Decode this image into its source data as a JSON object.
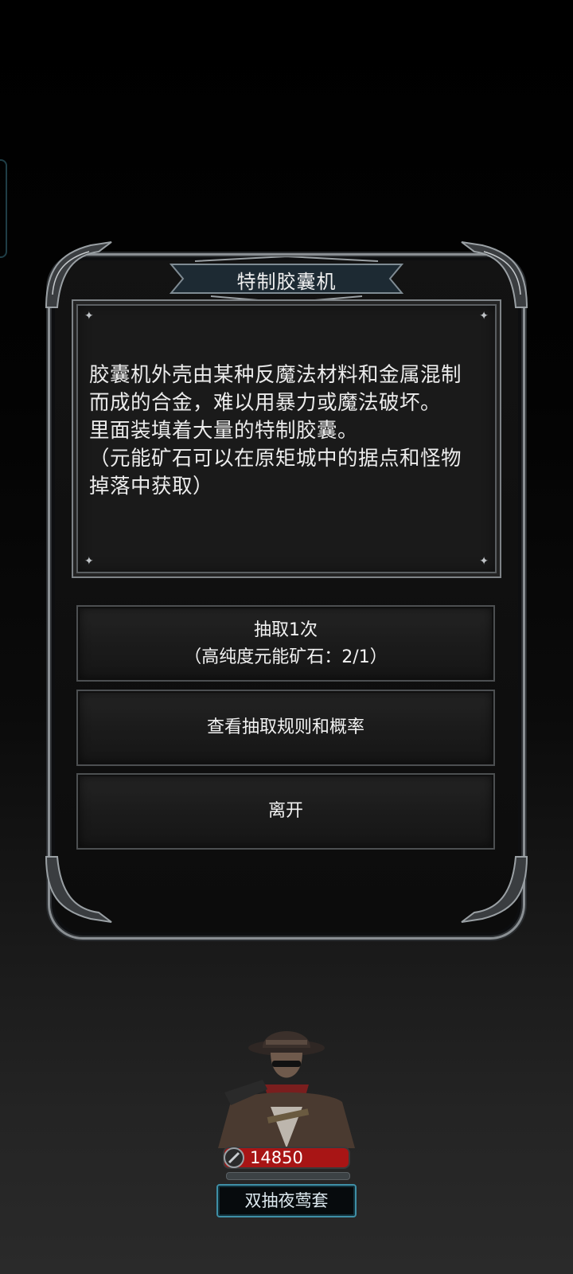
{
  "dialog": {
    "title": "特制胶囊机",
    "description": "胶囊机外壳由某种反魔法材料和金属混制\n而成的合金，难以用暴力或魔法破坏。\n里面装填着大量的特制胶囊。\n（元能矿石可以在原矩城中的据点和怪物\n掉落中获取）"
  },
  "buttons": {
    "draw": {
      "label": "抽取1次",
      "cost": "（高纯度元能矿石：2/1）"
    },
    "rules_label": "查看抽取规则和概率",
    "leave_label": "离开"
  },
  "character": {
    "hp": "14850",
    "name": "双抽夜莺套"
  },
  "icons": {
    "hp": "blade-icon",
    "deco": "sparkle-icon"
  },
  "colors": {
    "frame": "#8a8f93",
    "hp_bar": "#c91d1d",
    "name_plate_border": "#3f8fa6"
  }
}
